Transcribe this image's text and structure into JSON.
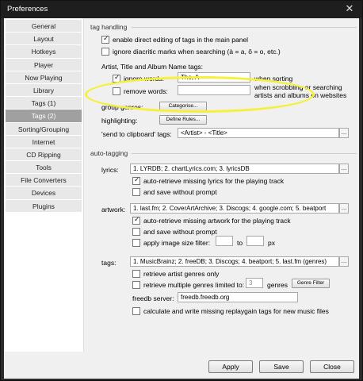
{
  "window": {
    "title": "Preferences",
    "close_glyph": "✕"
  },
  "sidebar": {
    "items": [
      {
        "label": "General"
      },
      {
        "label": "Layout"
      },
      {
        "label": "Hotkeys"
      },
      {
        "label": "Player"
      },
      {
        "label": "Now Playing"
      },
      {
        "label": "Library"
      },
      {
        "label": "Tags (1)"
      },
      {
        "label": "Tags (2)",
        "selected": true
      },
      {
        "label": "Sorting/Grouping"
      },
      {
        "label": "Internet"
      },
      {
        "label": "CD Ripping"
      },
      {
        "label": "Tools"
      },
      {
        "label": "File Converters"
      },
      {
        "label": "Devices"
      },
      {
        "label": "Plugins"
      }
    ]
  },
  "tag_handling": {
    "title": "tag handling",
    "enable_direct_edit": "enable direct editing of tags in the main panel",
    "ignore_diacritic": "ignore diacritic marks when searching (à = a, ô = o, etc.)",
    "artist_title_label": "Artist, Title and Album Name tags:",
    "ignore_words_label": "ignore words:",
    "ignore_words_value": "The, A",
    "when_sorting": "when sorting",
    "remove_words_label": "remove words:",
    "remove_words_value": "",
    "remove_note_1": "when scrobbling or searching",
    "remove_note_2": "artists and albums on websites",
    "group_genres_label": "group genres:",
    "categorise_btn": "Categorise...",
    "highlighting_label": "highlighting:",
    "define_rules_btn": "Define Rules...",
    "send_clipboard_label": "'send to clipboard' tags:",
    "send_clipboard_value": "<Artist> - <Title>"
  },
  "auto_tagging": {
    "title": "auto-tagging",
    "lyrics_label": "lyrics:",
    "lyrics_value": "1. LYRDB; 2. chartLyrics.com; 3. lyricsDB",
    "lyrics_auto": "auto-retrieve missing lyrics for the playing track",
    "lyrics_save": "and save without prompt",
    "artwork_label": "artwork:",
    "artwork_value": "1. last.fm; 2. CoverArtArchive; 3. Discogs; 4. google.com; 5. beatport",
    "artwork_auto": "auto-retrieve missing artwork for the playing track",
    "artwork_save": "and save without prompt",
    "image_filter": "apply image size filter:",
    "to_label": "to",
    "px_label": "px",
    "tags_label": "tags:",
    "tags_value": "1. MusicBrainz; 2. freeDB; 3. Discogs; 4. beatport; 5. last.fm (genres)",
    "retrieve_artist": "retrieve artist genres only",
    "retrieve_multiple": "retrieve multiple genres limited to:",
    "genres_count": "3",
    "genres_label": "genres",
    "genre_filter_btn": "Genre Filter",
    "freedb_label": "freedb server:",
    "freedb_value": "freedb.freedb.org",
    "replaygain": "calculate and write missing replaygain tags for new music files"
  },
  "footer": {
    "apply": "Apply",
    "save": "Save",
    "close": "Close"
  },
  "ellipsis": "..."
}
